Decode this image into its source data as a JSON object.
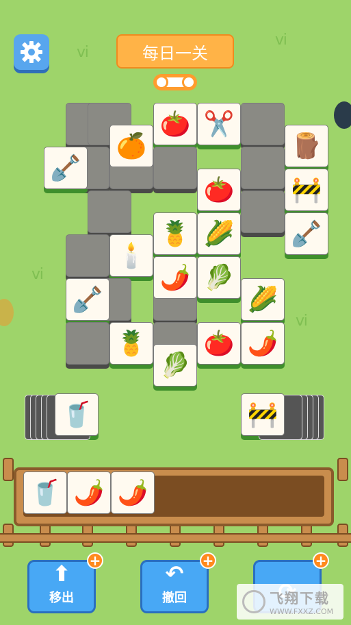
{
  "header": {
    "title": "每日一关"
  },
  "buttons": {
    "move_out": "移出",
    "undo": "撤回",
    "shuffle": "",
    "plus": "+"
  },
  "icons": {
    "settings": "gear-icon",
    "move_out": "arrow-up-icon",
    "undo": "undo-arrow-icon",
    "shuffle": "refresh-icon"
  },
  "board": {
    "tiles": [
      {
        "item": "tomato",
        "glyph": "🍅",
        "state": "active"
      },
      {
        "item": "scissors",
        "glyph": "✂️",
        "state": "active"
      },
      {
        "item": "orange",
        "glyph": "🍊",
        "state": "active"
      },
      {
        "item": "stump",
        "glyph": "🪵",
        "state": "active"
      },
      {
        "item": "shovel",
        "glyph": "🪏",
        "state": "active"
      },
      {
        "item": "tomato",
        "glyph": "🍅",
        "state": "active"
      },
      {
        "item": "cone",
        "glyph": "🚧",
        "state": "active"
      },
      {
        "item": "pineapple",
        "glyph": "🍍",
        "state": "active"
      },
      {
        "item": "corn",
        "glyph": "🌽",
        "state": "active"
      },
      {
        "item": "shovel",
        "glyph": "🪏",
        "state": "active"
      },
      {
        "item": "candle",
        "glyph": "🕯️",
        "state": "active"
      },
      {
        "item": "chili",
        "glyph": "🌶️",
        "state": "active"
      },
      {
        "item": "cabbage",
        "glyph": "🥬",
        "state": "active"
      },
      {
        "item": "corn",
        "glyph": "🌽",
        "state": "active"
      },
      {
        "item": "shovel",
        "glyph": "🪏",
        "state": "active"
      },
      {
        "item": "pineapple",
        "glyph": "🍍",
        "state": "active"
      },
      {
        "item": "tomato",
        "glyph": "🍅",
        "state": "active"
      },
      {
        "item": "chili",
        "glyph": "🌶️",
        "state": "active"
      },
      {
        "item": "cabbage",
        "glyph": "🥬",
        "state": "active"
      }
    ]
  },
  "left_stack": {
    "top_item": "cup",
    "glyph": "🥤"
  },
  "right_stack": {
    "top_item": "cone",
    "glyph": "🚧"
  },
  "tray": {
    "slots": [
      {
        "item": "cup",
        "glyph": "🥤"
      },
      {
        "item": "chili",
        "glyph": "🌶️"
      },
      {
        "item": "chili",
        "glyph": "🌶️"
      }
    ]
  },
  "watermark": {
    "main": "飞翔下载",
    "sub": "WWW.FXXZ.COM"
  },
  "colors": {
    "background": "#9ed46a",
    "title_bg": "#ffb347",
    "button_blue": "#48a8f5",
    "tile_edge": "#3f8f2c"
  }
}
